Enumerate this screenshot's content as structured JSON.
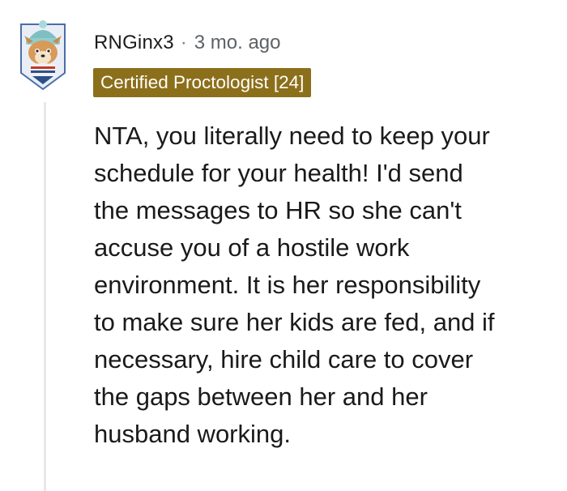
{
  "comment": {
    "username": "RNGinx3",
    "separator": "·",
    "timestamp": "3 mo. ago",
    "flair": "Certified Proctologist [24]",
    "body_lines": [
      "NTA, you literally need to keep your",
      "schedule for your health! I'd send",
      "the messages to HR so she can't",
      "accuse you of a hostile work",
      "environment. It is her responsibility",
      "to make sure her kids are fed, and if",
      "necessary, hire child care to cover",
      "the gaps between her and her",
      "husband working."
    ]
  },
  "colors": {
    "flair_background": "#8c6f1a",
    "flair_text": "#ffffff",
    "thread_line": "#e6e8ea",
    "meta_text": "#5e6266",
    "body_text": "#1a1a1b"
  },
  "icons": {
    "avatar": "snoo-avatar-icon"
  }
}
